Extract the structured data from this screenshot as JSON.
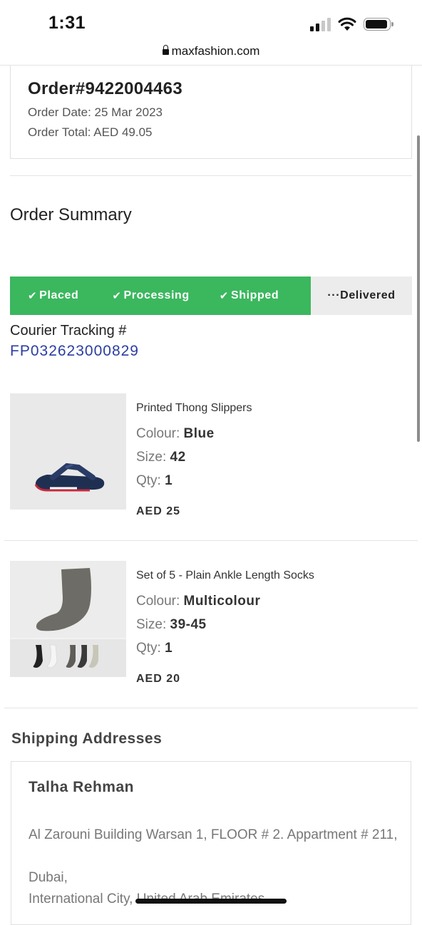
{
  "status_bar": {
    "time": "1:31"
  },
  "browser": {
    "url": "maxfashion.com"
  },
  "order": {
    "number": "Order#9422004463",
    "date": "Order Date: 25 Mar 2023",
    "total": "Order Total: AED 49.05"
  },
  "summary_title": "Order Summary",
  "progress": {
    "steps": [
      {
        "label": "Placed",
        "done": true
      },
      {
        "label": "Processing",
        "done": true
      },
      {
        "label": "Shipped",
        "done": true
      }
    ],
    "pending": "···Delivered"
  },
  "tracking": {
    "label": "Courier Tracking #",
    "number": "FP032623000829"
  },
  "labels": {
    "colour": "Colour:",
    "size": "Size:",
    "qty": "Qty:"
  },
  "products": [
    {
      "name": "Printed Thong Slippers",
      "colour": "Blue",
      "size": "42",
      "qty": "1",
      "price": "AED 25"
    },
    {
      "name": "Set of 5 - Plain Ankle Length Socks",
      "colour": "Multicolour",
      "size": "39-45",
      "qty": "1",
      "price": "AED 20"
    }
  ],
  "shipping": {
    "title": "Shipping Addresses",
    "name": "Talha Rehman",
    "address_line1": "Al Zarouni Building Warsan 1, FLOOR # 2. Appartment # 211,",
    "address_line2": "Dubai,",
    "address_line3": "International City, United Arab Emirates"
  },
  "colors": {
    "accent_green": "#3bb75e",
    "tracking_blue": "#2c3da1",
    "pending_gray": "#ececec"
  }
}
